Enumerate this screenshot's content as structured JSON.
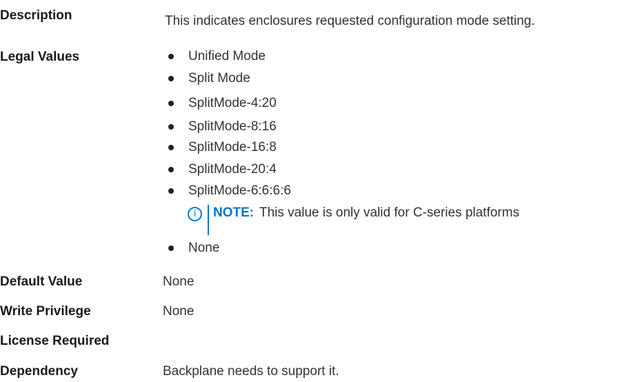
{
  "description": {
    "term": "Description",
    "value": "This indicates enclosures requested configuration mode setting."
  },
  "legal_values": {
    "term": "Legal Values",
    "items": [
      "Unified Mode",
      "Split Mode",
      "SplitMode-4:20",
      "SplitMode-8:16",
      "SplitMode-16:8",
      "SplitMode-20:4",
      "SplitMode-6:6:6:6",
      "None"
    ],
    "note": {
      "icon": "info-icon",
      "icon_glyph": "i",
      "label": "NOTE:",
      "text": "This value is only valid for C-series platforms",
      "color": "#0076ce"
    }
  },
  "default_value": {
    "term": "Default Value",
    "value": "None"
  },
  "write_privilege": {
    "term": "Write Privilege",
    "value": "None"
  },
  "license_required": {
    "term": "License Required",
    "value": ""
  },
  "dependency": {
    "term": "Dependency",
    "value": "Backplane needs to support it."
  }
}
